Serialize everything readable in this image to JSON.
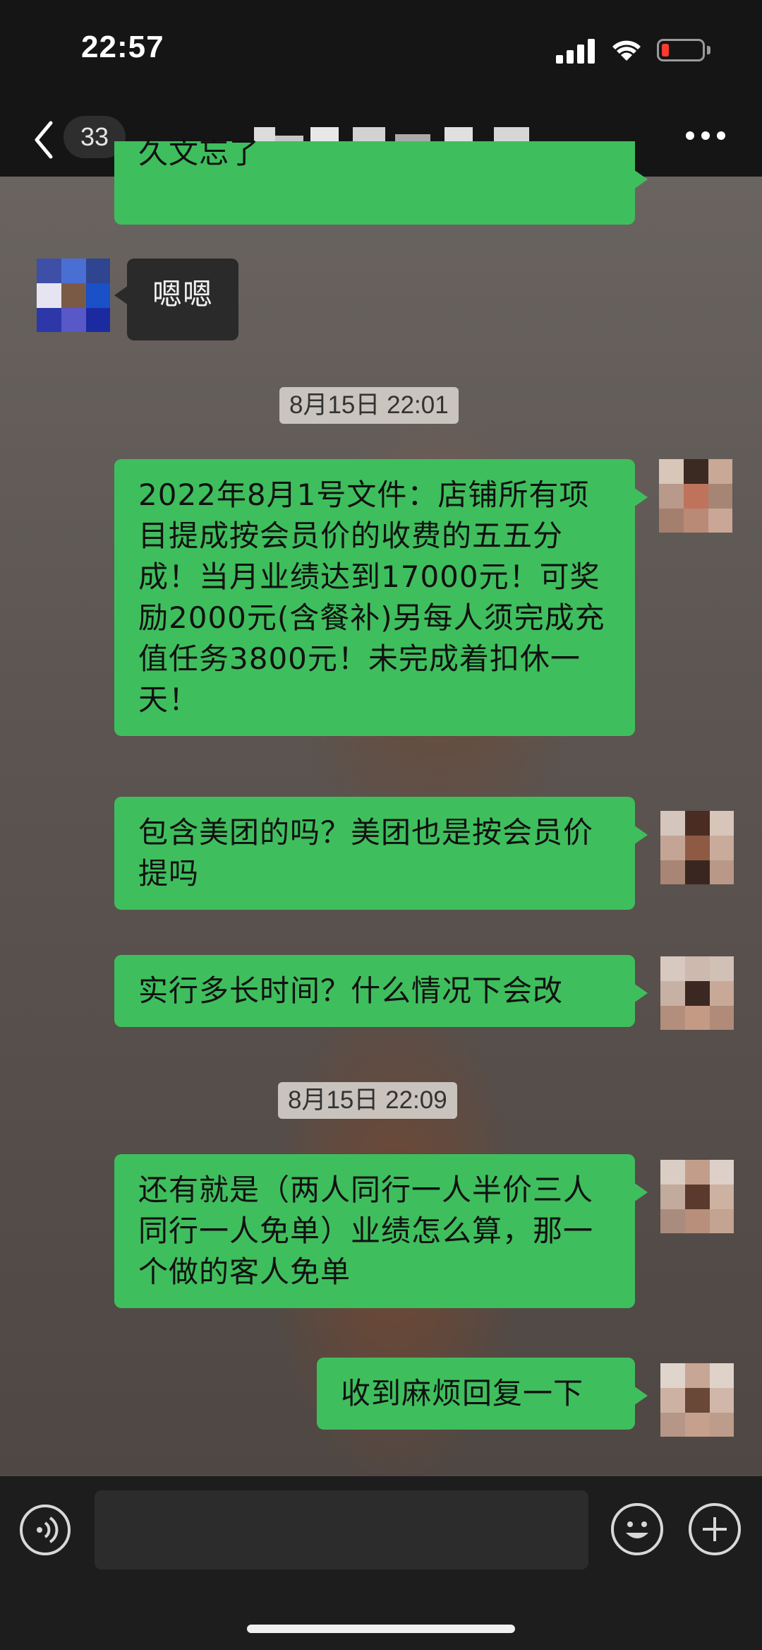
{
  "status_bar": {
    "time": "22:57"
  },
  "header": {
    "unread_count": "33"
  },
  "messages": [
    {
      "type": "outgoing",
      "text": "久文忘了"
    },
    {
      "type": "incoming",
      "text": "嗯嗯"
    },
    {
      "type": "timestamp",
      "text": "8月15日 22:01"
    },
    {
      "type": "outgoing",
      "text": "2022年8月1号文件：店铺所有项目提成按会员价的收费的五五分成！当月业绩达到17000元！可奖励2000元(含餐补)另每人须完成充值任务3800元！未完成着扣休一天！"
    },
    {
      "type": "outgoing",
      "text": "包含美团的吗？美团也是按会员价提吗"
    },
    {
      "type": "outgoing",
      "text": "实行多长时间？什么情况下会改"
    },
    {
      "type": "timestamp",
      "text": "8月15日 22:09"
    },
    {
      "type": "outgoing",
      "text": "还有就是（两人同行一人半价三人同行一人免单）业绩怎么算，那一个做的客人免单"
    },
    {
      "type": "outgoing",
      "text": "收到麻烦回复一下"
    }
  ],
  "colors": {
    "outgoing_bubble": "#3fbe5d",
    "incoming_bubble": "#2a2a2a",
    "header_bg": "#151515"
  },
  "icons": [
    "back-chevron-icon",
    "more-icon",
    "voice-icon",
    "emoji-icon",
    "add-icon"
  ]
}
